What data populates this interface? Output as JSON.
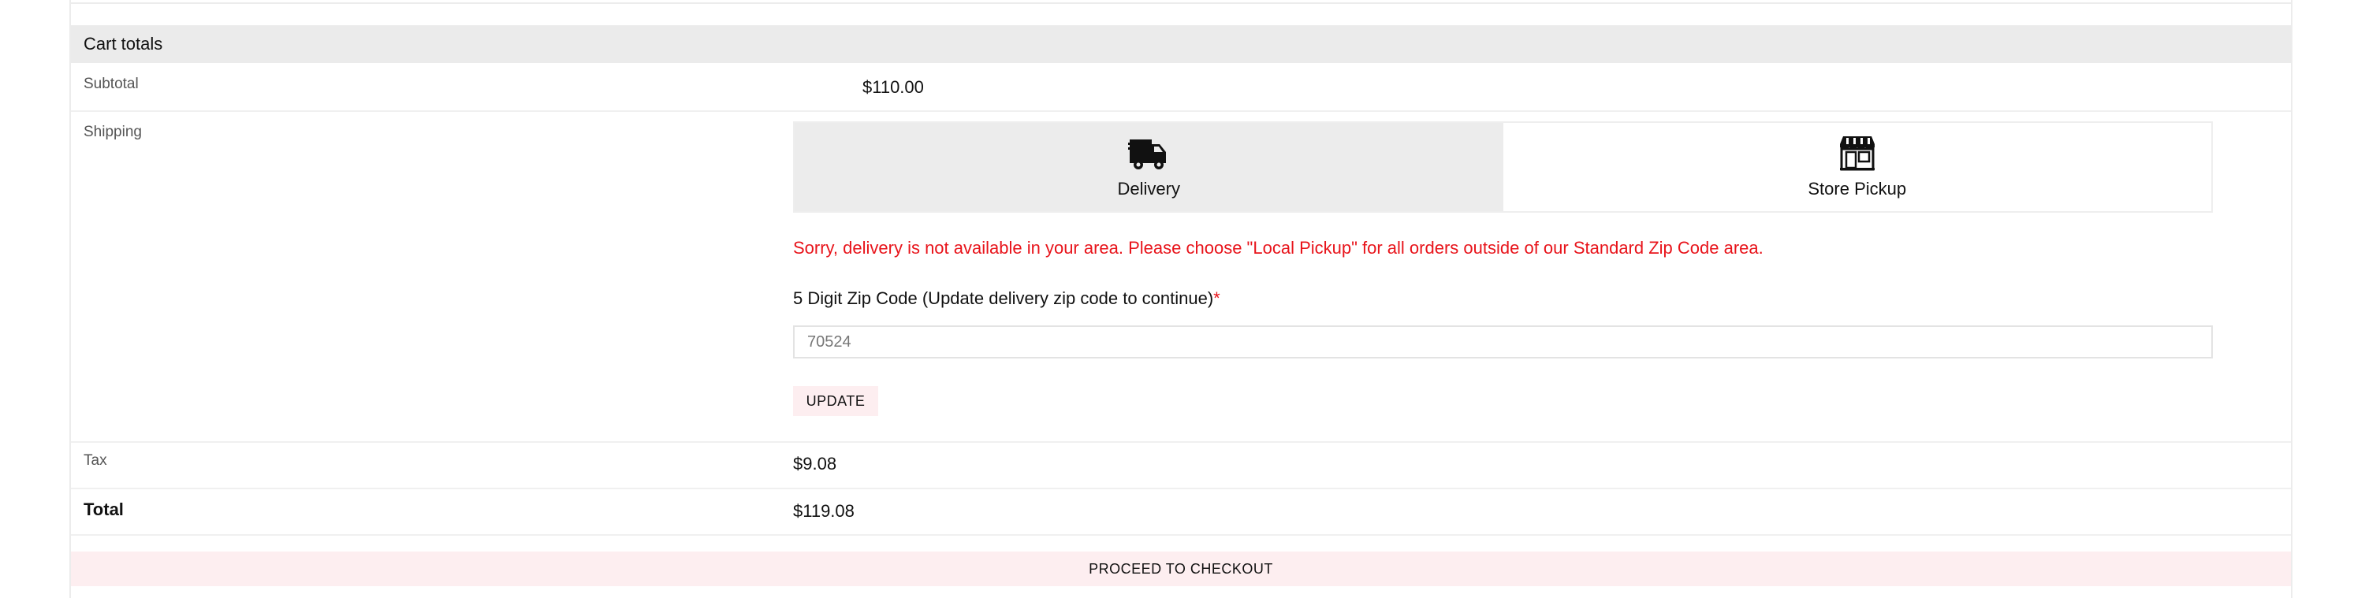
{
  "cart_totals": {
    "title": "Cart totals",
    "subtotal": {
      "label": "Subtotal",
      "value": "$110.00"
    },
    "shipping": {
      "label": "Shipping",
      "options": [
        {
          "label": "Delivery",
          "icon": "delivery-truck-icon",
          "selected": true
        },
        {
          "label": "Store Pickup",
          "icon": "storefront-icon",
          "selected": false
        }
      ],
      "error_message": "Sorry, delivery is not available in your area. Please choose \"Local Pickup\" for all orders outside of our Standard Zip Code area.",
      "zip_label": "5 Digit Zip Code  (Update delivery zip code to continue)",
      "zip_required_marker": "*",
      "zip_value": "70524",
      "update_label": "UPDATE"
    },
    "tax": {
      "label": "Tax",
      "value": "$9.08"
    },
    "total": {
      "label": "Total",
      "value": "$119.08"
    },
    "checkout_label": "PROCEED TO CHECKOUT"
  },
  "colors": {
    "error": "#e8141b",
    "button_bg": "#fdeef0",
    "header_bg": "#ebebeb",
    "selected_option_bg": "#ececec"
  }
}
